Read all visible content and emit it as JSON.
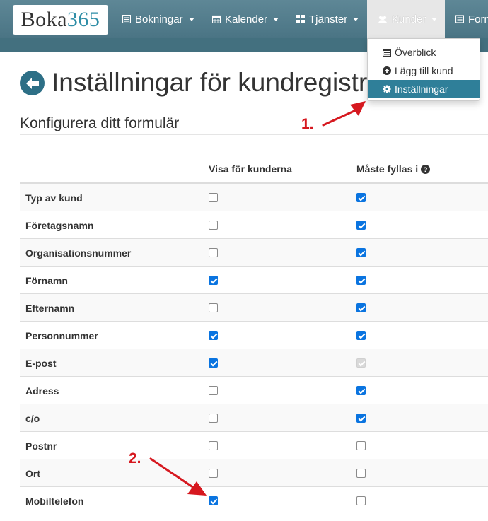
{
  "logo": {
    "text_a": "Boka",
    "text_b": "365"
  },
  "nav": {
    "items": [
      {
        "label": "Bokningar",
        "icon": "list-icon"
      },
      {
        "label": "Kalender",
        "icon": "calendar-icon"
      },
      {
        "label": "Tjänster",
        "icon": "grid-icon"
      },
      {
        "label": "Kunder",
        "icon": "users-icon",
        "active": true
      },
      {
        "label": "Form",
        "icon": "form-icon"
      }
    ],
    "dropdown": [
      {
        "label": "Överblick",
        "icon": "overview-icon"
      },
      {
        "label": "Lägg till kund",
        "icon": "plus-circle-icon"
      },
      {
        "label": "Inställningar",
        "icon": "cog-icon",
        "active": true
      }
    ]
  },
  "page": {
    "title": "Inställningar för kundregistr",
    "subtitle": "Konfigurera ditt formulär"
  },
  "table": {
    "col_show": "Visa för kunderna",
    "col_required": "Måste fyllas i",
    "rows": [
      {
        "label": "Typ av kund",
        "show": false,
        "required": true
      },
      {
        "label": "Företagsnamn",
        "show": false,
        "required": true
      },
      {
        "label": "Organisationsnummer",
        "show": false,
        "required": true
      },
      {
        "label": "Förnamn",
        "show": true,
        "required": true
      },
      {
        "label": "Efternamn",
        "show": false,
        "required": true
      },
      {
        "label": "Personnummer",
        "show": true,
        "required": true
      },
      {
        "label": "E-post",
        "show": true,
        "required": true,
        "required_disabled": true
      },
      {
        "label": "Adress",
        "show": false,
        "required": true
      },
      {
        "label": "c/o",
        "show": false,
        "required": true
      },
      {
        "label": "Postnr",
        "show": false,
        "required": false
      },
      {
        "label": "Ort",
        "show": false,
        "required": false
      },
      {
        "label": "Mobiltelefon",
        "show": true,
        "required": false
      }
    ]
  },
  "annotations": {
    "one": "1.",
    "two": "2."
  },
  "colors": {
    "navbar": "#4b7585",
    "accent": "#2f7f99",
    "checkbox": "#0a74e0",
    "annotation": "#d6181f"
  }
}
